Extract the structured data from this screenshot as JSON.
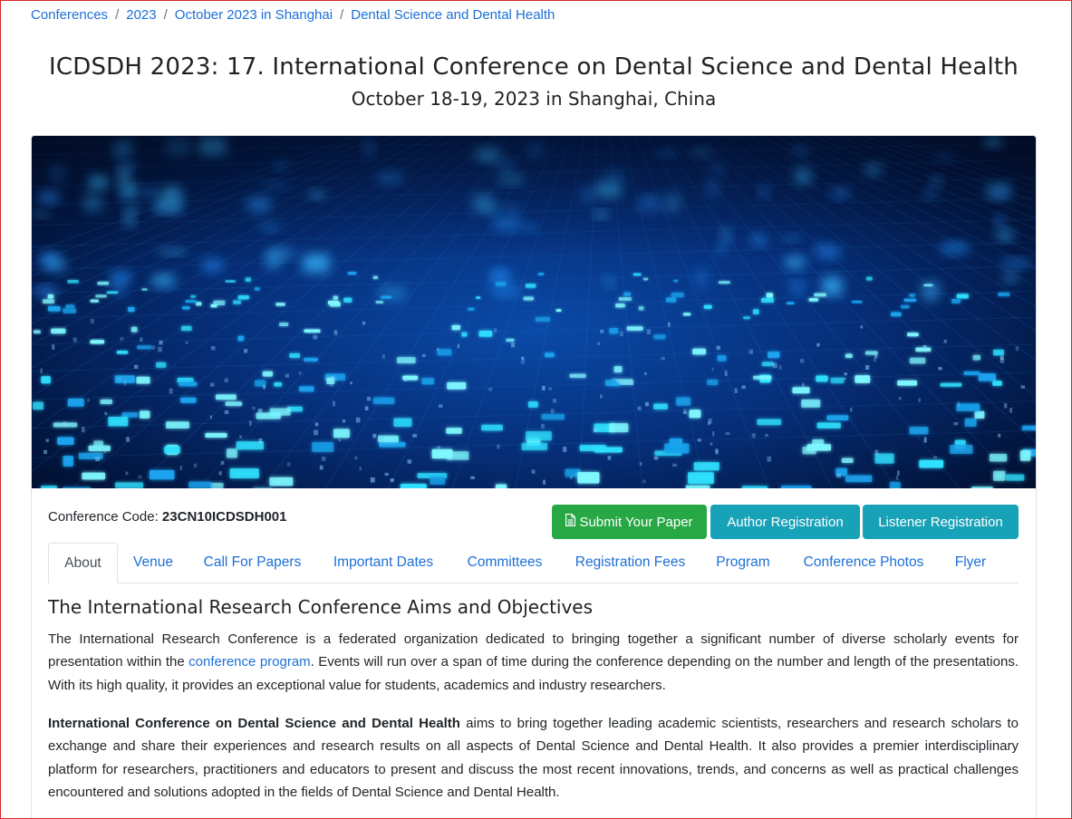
{
  "breadcrumb": {
    "items": [
      "Conferences",
      "2023",
      "October 2023 in Shanghai",
      "Dental Science and Dental Health"
    ],
    "separator": "/"
  },
  "header": {
    "title": "ICDSDH 2023: 17. International Conference on Dental Science and Dental Health",
    "subtitle": "October 18-19, 2023 in Shanghai, China"
  },
  "conference": {
    "code_label": "Conference Code:",
    "code_value": "23CN10ICDSDH001"
  },
  "actions": {
    "submit_label": "Submit Your Paper",
    "submit_icon": "file-text-icon",
    "author_label": "Author Registration",
    "listener_label": "Listener Registration"
  },
  "tabs": [
    {
      "label": "About",
      "active": true
    },
    {
      "label": "Venue"
    },
    {
      "label": "Call For Papers"
    },
    {
      "label": "Important Dates"
    },
    {
      "label": "Committees"
    },
    {
      "label": "Registration Fees"
    },
    {
      "label": "Program"
    },
    {
      "label": "Conference Photos"
    },
    {
      "label": "Flyer"
    }
  ],
  "about": {
    "heading": "The International Research Conference Aims and Objectives",
    "p1_before": "The International Research Conference is a federated organization dedicated to bringing together a significant number of diverse scholarly events for presentation within the ",
    "p1_link": "conference program",
    "p1_after": ". Events will run over a span of time during the conference depending on the number and length of the presentations. With its high quality, it provides an exceptional value for students, academics and industry researchers.",
    "p2_bold": "International Conference on Dental Science and Dental Health",
    "p2_rest": " aims to bring together leading academic scientists, researchers and research scholars to exchange and share their experiences and research results on all aspects of Dental Science and Dental Health. It also provides a premier interdisciplinary platform for researchers, practitioners and educators to present and discuss the most recent innovations, trends, and concerns as well as practical challenges encountered and solutions adopted in the fields of Dental Science and Dental Health."
  },
  "colors": {
    "link": "#1d6fd6",
    "success": "#28a745",
    "info": "#17a2b8",
    "frame_border": "#d9262a"
  }
}
